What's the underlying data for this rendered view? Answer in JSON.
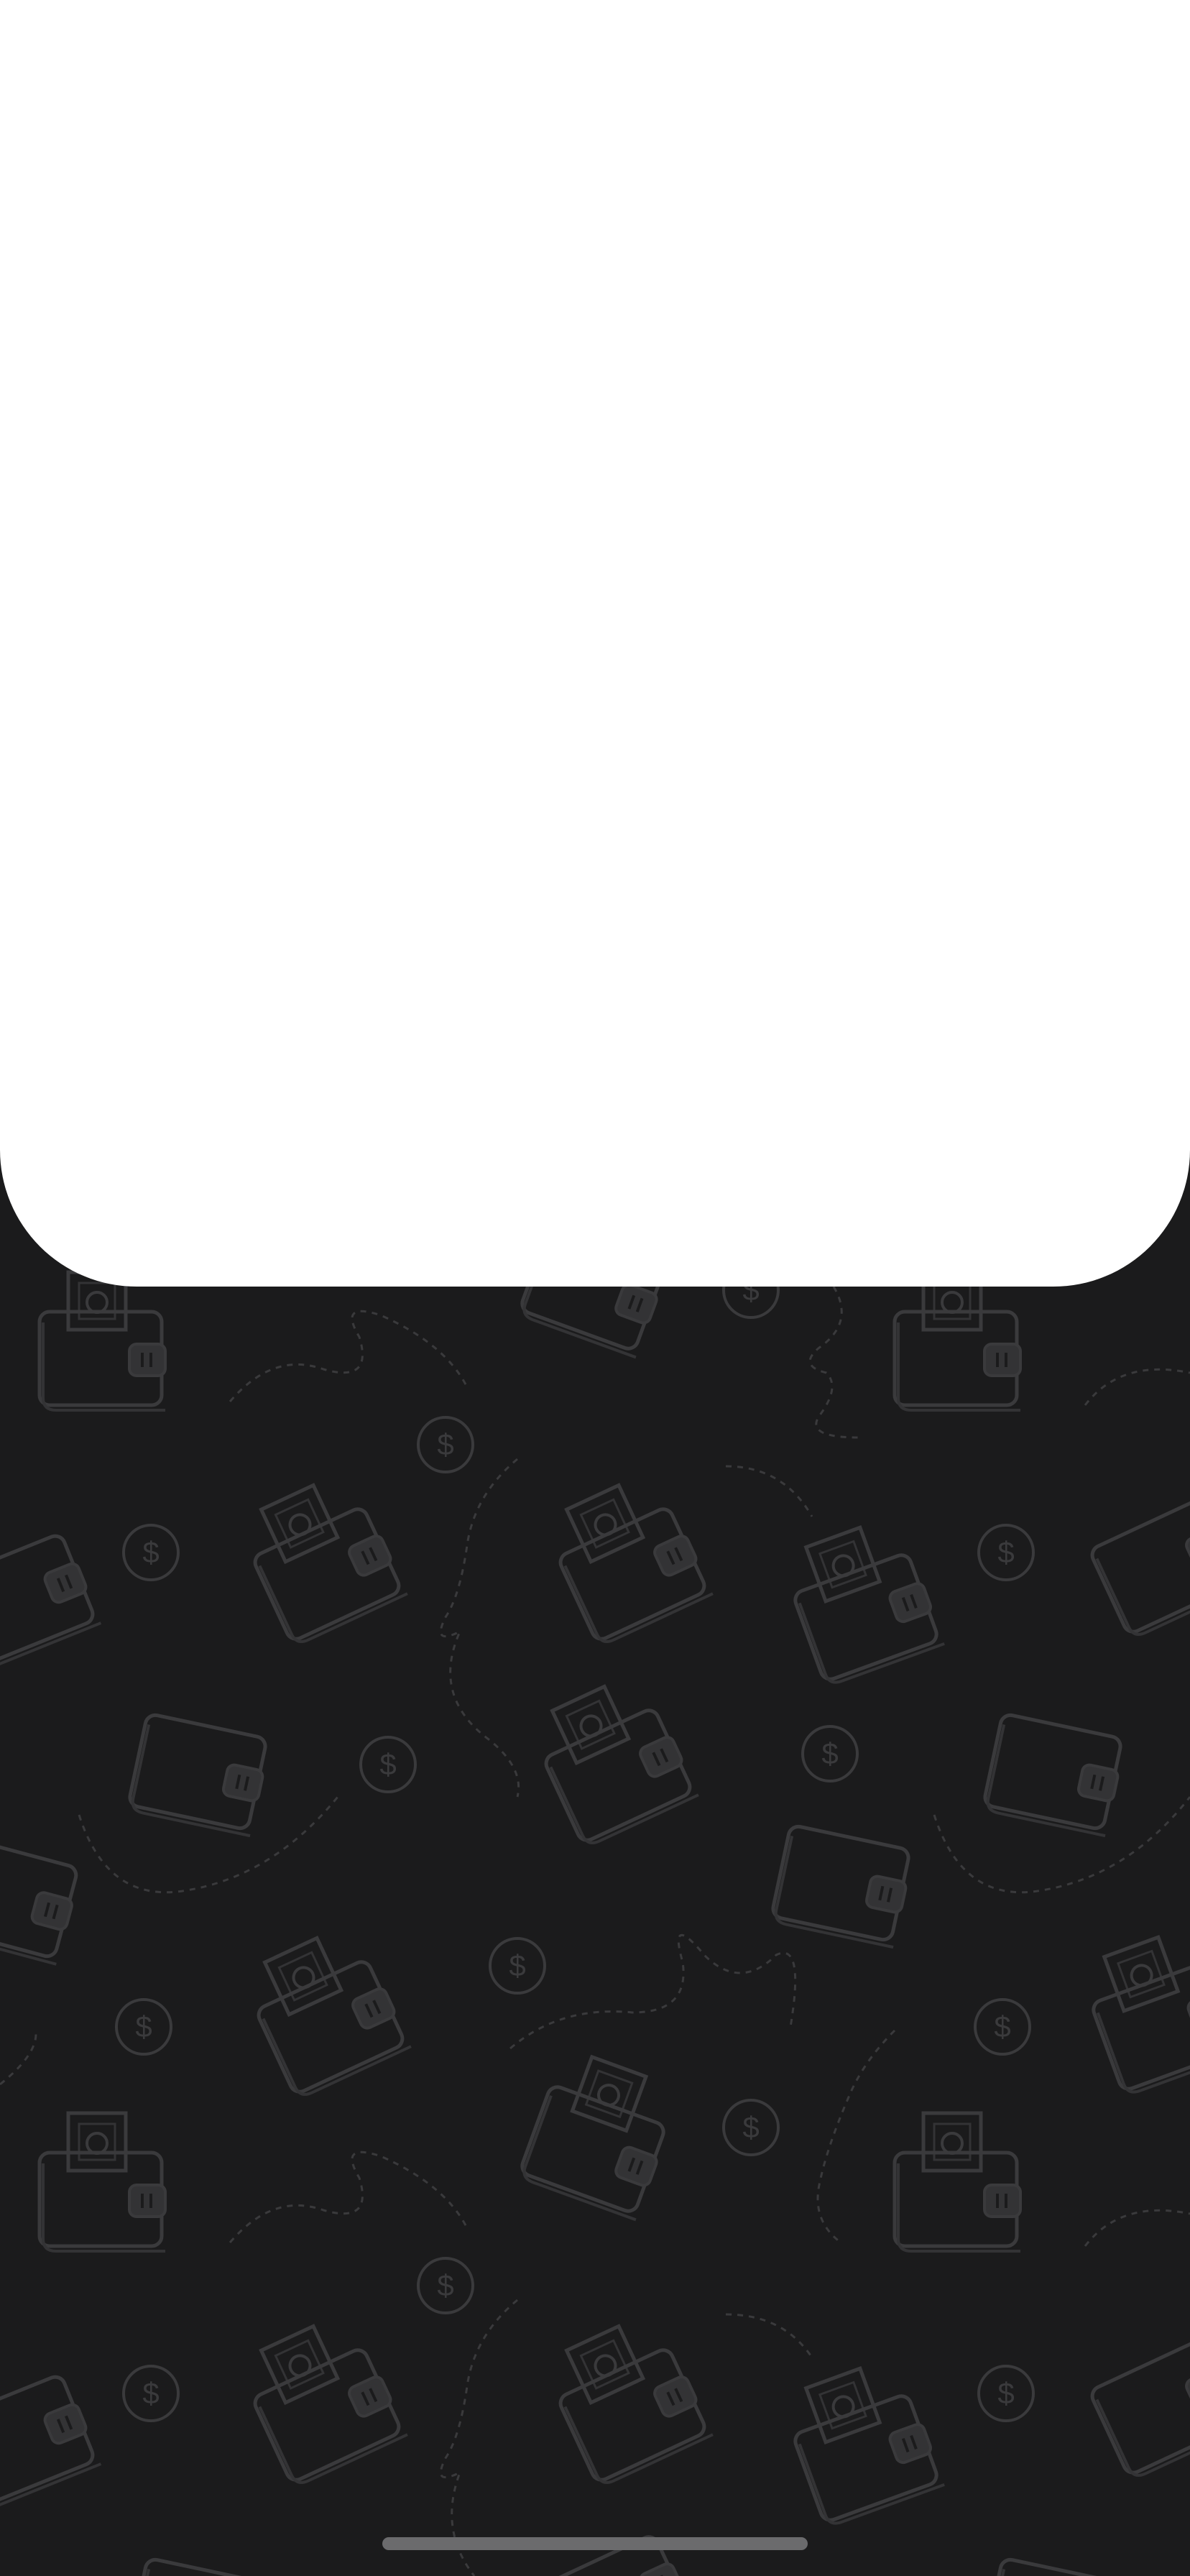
{
  "screen": {
    "background_color": "#1b1b1c",
    "pattern_stroke_color": "#3a3a3c",
    "pattern_motifs": [
      "wallet-with-cash-icon",
      "wallet-icon",
      "dollar-coin-icon",
      "dashed-flight-path"
    ],
    "card_color": "#ffffff"
  },
  "system": {
    "home_indicator_color": "#6b6b6d"
  }
}
